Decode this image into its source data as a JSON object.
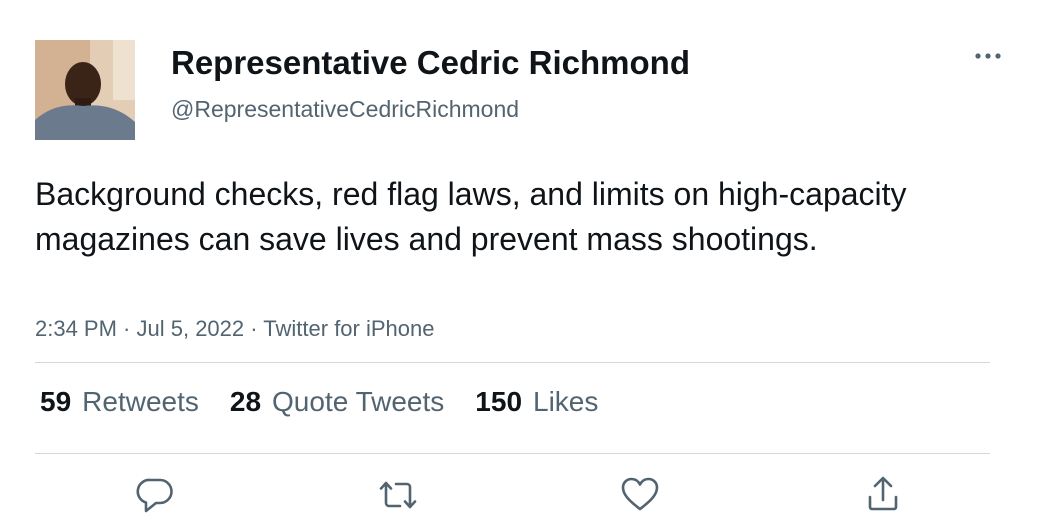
{
  "author": {
    "display_name": "Representative Cedric Richmond",
    "handle": "@RepresentativeCedricRichmond"
  },
  "tweet": {
    "text": "Background checks, red flag laws, and limits on high-capacity magazines can save lives and prevent mass shootings.",
    "time": "2:34 PM",
    "separator1": " · ",
    "date": "Jul 5, 2022",
    "separator2": " · ",
    "source": "Twitter for iPhone"
  },
  "stats": {
    "retweets_count": "59",
    "retweets_label": "Retweets",
    "quotes_count": "28",
    "quotes_label": "Quote Tweets",
    "likes_count": "150",
    "likes_label": "Likes"
  },
  "actions": [
    "reply-icon",
    "retweet-icon",
    "like-icon",
    "share-icon"
  ],
  "menu_icon": "more-options-icon",
  "colors": {
    "text_primary": "#0f1419",
    "text_secondary": "#536471",
    "divider": "#cfd9de",
    "icon": "#536471"
  }
}
